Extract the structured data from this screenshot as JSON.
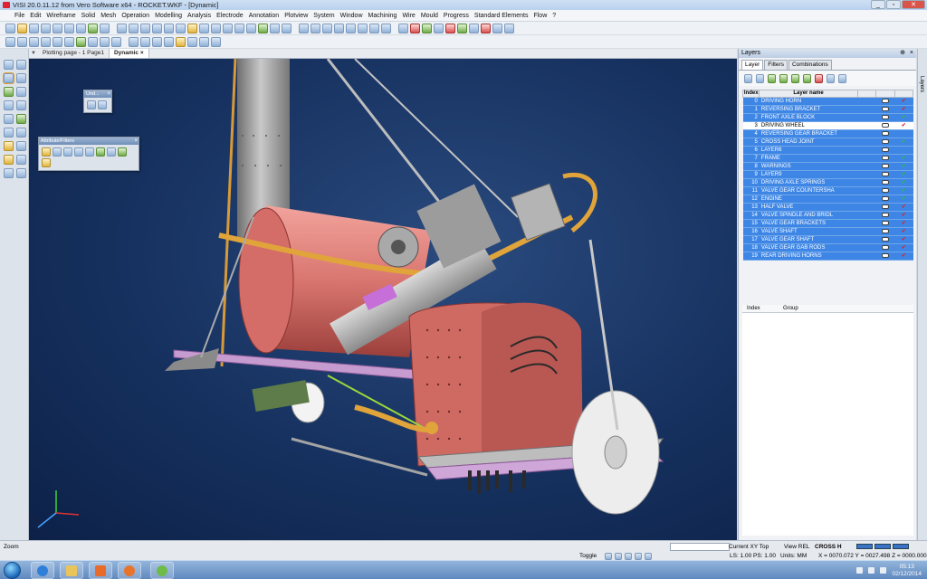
{
  "window": {
    "title": "VISI 20.0.11.12 from Vero Software x64 - ROCKET.WKF - [Dynamic]",
    "controls": [
      "_",
      "▫",
      "✕"
    ]
  },
  "menu": [
    "File",
    "Edit",
    "Wireframe",
    "Solid",
    "Mesh",
    "Operation",
    "Modelling",
    "Analysis",
    "Electrode",
    "Annotation",
    "Plotview",
    "System",
    "Window",
    "Machining",
    "Wire",
    "Mould",
    "Progress",
    "Standard Elements",
    "Flow",
    "?"
  ],
  "tabs": {
    "plot": "Plotting page - 1 Page1",
    "dynamic": "Dynamic",
    "close": "×"
  },
  "panels": {
    "undo_title": "Und...",
    "attr_title": "Attribute/Filters",
    "close": "×"
  },
  "layers": {
    "title": "Layers",
    "tabs": [
      "Layer",
      "Filters",
      "Combinations"
    ],
    "headers": {
      "index": "Index",
      "name": "Layer name"
    },
    "rows": [
      {
        "index": "0",
        "name": "DRIVING HORN",
        "state": "sel",
        "mark": "red"
      },
      {
        "index": "1",
        "name": "REVERSING BRACKET",
        "state": "sel",
        "mark": "red"
      },
      {
        "index": "2",
        "name": "FRONT AXLE BLOCK",
        "state": "sel",
        "mark": "green"
      },
      {
        "index": "3",
        "name": "DRIVING WHEEL",
        "state": "cur",
        "mark": "red"
      },
      {
        "index": "4",
        "name": "REVERSING GEAR BRACKET",
        "state": "sel",
        "mark": "none"
      },
      {
        "index": "5",
        "name": "CROSS HEAD JOINT",
        "state": "sel",
        "mark": "green"
      },
      {
        "index": "6",
        "name": "LAYER6",
        "state": "sel",
        "mark": "none"
      },
      {
        "index": "7",
        "name": "FRAME",
        "state": "sel",
        "mark": "green"
      },
      {
        "index": "8",
        "name": "WARNINGS",
        "state": "sel",
        "mark": "green"
      },
      {
        "index": "9",
        "name": "LAYER9",
        "state": "sel",
        "mark": "green"
      },
      {
        "index": "10",
        "name": "DRIVING AXLE SPRINGS",
        "state": "sel",
        "mark": "green"
      },
      {
        "index": "11",
        "name": "VALVE GEAR COUNTERSHA",
        "state": "sel",
        "mark": "green"
      },
      {
        "index": "12",
        "name": "ENGINE",
        "state": "sel",
        "mark": "green"
      },
      {
        "index": "13",
        "name": "HALF VALVE",
        "state": "sel",
        "mark": "red"
      },
      {
        "index": "14",
        "name": "VALVE SPINDLE AND BRIDL",
        "state": "sel",
        "mark": "red"
      },
      {
        "index": "15",
        "name": "VALVE GEAR BRACKETS",
        "state": "sel",
        "mark": "red"
      },
      {
        "index": "16",
        "name": "VALVE SHAFT",
        "state": "sel",
        "mark": "red"
      },
      {
        "index": "17",
        "name": "VALVE GEAR SHAFT",
        "state": "sel",
        "mark": "red"
      },
      {
        "index": "18",
        "name": "VALVE GEAR GAB RODS",
        "state": "sel",
        "mark": "red"
      },
      {
        "index": "19",
        "name": "REAR DRIVING HORNS",
        "state": "sel",
        "mark": "red"
      }
    ],
    "group_headers": {
      "index": "Index",
      "group": "Group"
    },
    "side_tab": "Layers"
  },
  "status": {
    "prompt": "Zoom",
    "toggle": "Toggle",
    "scale": "LS: 1.00  PS: 1.00",
    "units": "Units: MM",
    "view": "Current XY Top",
    "view_rel": "View REL",
    "cross": "CROSS H",
    "coords": "X = 0070.072 Y = 0027.498 Z = 0000.000"
  },
  "taskbar": {
    "time": "05:13",
    "date": "02/12/2014"
  },
  "colors": {
    "viewport_bg": "#16315f",
    "boiler": "#d9756f",
    "selection": "#3e86e6",
    "pipe": "#e0a43a"
  }
}
